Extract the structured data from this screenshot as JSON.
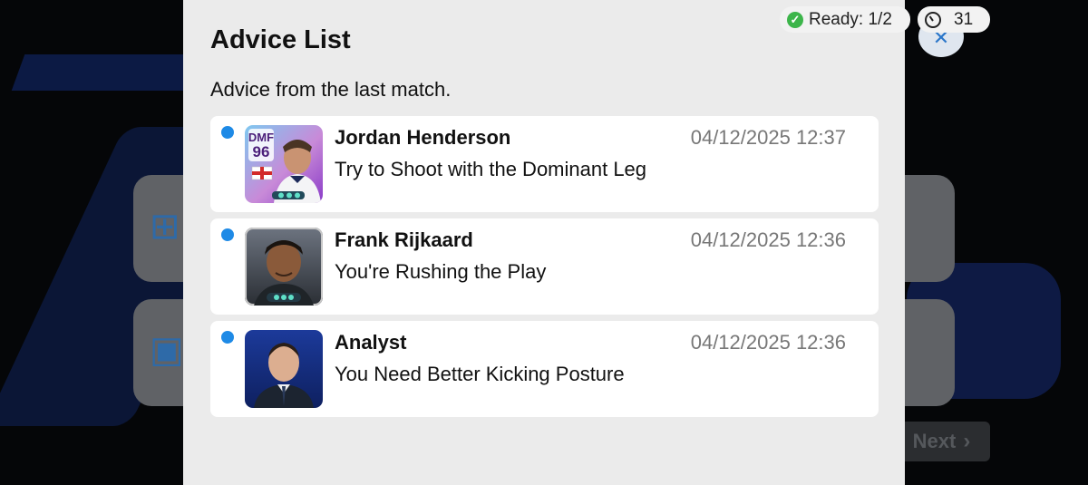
{
  "status": {
    "ready_label": "Ready: 1/2",
    "timer_value": "31"
  },
  "dialog": {
    "title": "Advice List",
    "subtitle": "Advice from the last match.",
    "items": [
      {
        "sender": "Jordan Henderson",
        "message": "Try to Shoot with the Dominant Leg",
        "timestamp": "04/12/2025 12:37",
        "unread": true,
        "avatar_type": "player-card",
        "card_position": "DMF",
        "card_rating": "96"
      },
      {
        "sender": "Frank Rijkaard",
        "message": "You're Rushing the Play",
        "timestamp": "04/12/2025 12:36",
        "unread": true,
        "avatar_type": "player-card"
      },
      {
        "sender": "Analyst",
        "message": "You Need Better Kicking Posture",
        "timestamp": "04/12/2025 12:36",
        "unread": true,
        "avatar_type": "analyst-portrait"
      }
    ]
  },
  "background": {
    "next_label": "Next"
  },
  "colors": {
    "unread_dot": "#1e8ae6",
    "ready_check": "#3cb54a",
    "panel_bg": "#ebebeb",
    "timestamp": "#777777"
  }
}
